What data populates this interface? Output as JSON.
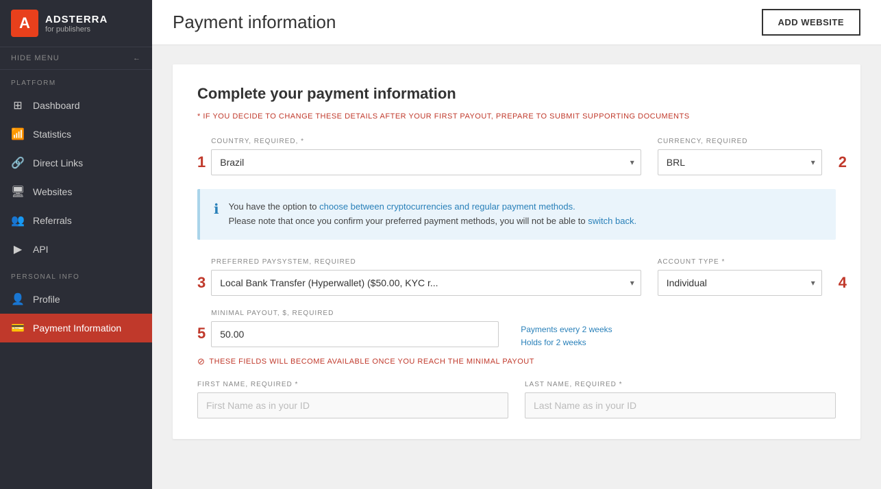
{
  "logo": {
    "letter": "A",
    "title": "ADSTERRA",
    "subtitle": "for publishers"
  },
  "sidebar": {
    "hide_menu_label": "HIDE MENU",
    "platform_label": "PLATFORM",
    "personal_info_label": "PERSONAL INFO",
    "items": [
      {
        "id": "dashboard",
        "label": "Dashboard",
        "icon": "⊞"
      },
      {
        "id": "statistics",
        "label": "Statistics",
        "icon": "📊"
      },
      {
        "id": "direct-links",
        "label": "Direct Links",
        "icon": "🔗"
      },
      {
        "id": "websites",
        "label": "Websites",
        "icon": "🖥"
      },
      {
        "id": "referrals",
        "label": "Referrals",
        "icon": "👥"
      },
      {
        "id": "api",
        "label": "API",
        "icon": "▶"
      }
    ],
    "personal_items": [
      {
        "id": "profile",
        "label": "Profile",
        "icon": "👤"
      },
      {
        "id": "payment-information",
        "label": "Payment Information",
        "icon": "💳",
        "active": true
      }
    ]
  },
  "topbar": {
    "title": "Payment information",
    "add_website_btn": "ADD WEBSITE"
  },
  "form": {
    "title": "Complete your payment information",
    "warning": "* IF YOU DECIDE TO CHANGE THESE DETAILS AFTER YOUR FIRST PAYOUT, PREPARE TO SUBMIT SUPPORTING DOCUMENTS",
    "country_label": "COUNTRY, REQUIRED, *",
    "country_value": "Brazil",
    "currency_label": "CURRENCY, REQUIRED",
    "currency_value": "BRL",
    "info_line1": "You have the option to choose between cryptocurrencies and regular payment methods.",
    "info_line2": "Please note that once you confirm your preferred payment methods, you will not be able to switch back.",
    "paysystem_label": "PREFERRED PAYSYSTEM, REQUIRED",
    "paysystem_value": "Local Bank Transfer (Hyperwallet) ($50.00, KYC r...",
    "account_type_label": "ACCOUNT TYPE *",
    "account_type_value": "Individual",
    "minimal_payout_label": "MINIMAL PAYOUT, $, REQUIRED",
    "minimal_payout_value": "50.00",
    "payments_hint1": "Payments every 2 weeks",
    "payments_hint2": "Holds for 2 weeks",
    "fields_notice": "THESE FIELDS WILL BECOME AVAILABLE ONCE YOU REACH THE MINIMAL PAYOUT",
    "first_name_label": "FIRST NAME, REQUIRED *",
    "first_name_placeholder": "First Name as in your ID",
    "last_name_label": "LAST NAME, REQUIRED *",
    "last_name_placeholder": "Last Name as in your ID",
    "step1": "1",
    "step2": "2",
    "step3": "3",
    "step4": "4",
    "step5": "5"
  }
}
